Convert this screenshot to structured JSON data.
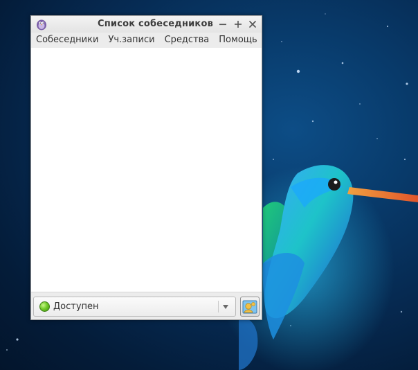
{
  "window": {
    "title": "Список собеседников",
    "controls": {
      "minimize_icon": "minimize-icon",
      "maximize_icon": "maximize-icon",
      "close_icon": "close-icon"
    }
  },
  "menubar": {
    "items": [
      {
        "label": "Собеседники"
      },
      {
        "label": "Уч.записи"
      },
      {
        "label": "Средства"
      },
      {
        "label": "Помощь"
      }
    ]
  },
  "status": {
    "selected": "Доступен",
    "indicator_color": "#6cc52a"
  },
  "colors": {
    "desktop_bg": "#062a52",
    "window_bg": "#ffffff",
    "chrome_bg": "#ececec",
    "title_text": "#3c3c3c"
  }
}
